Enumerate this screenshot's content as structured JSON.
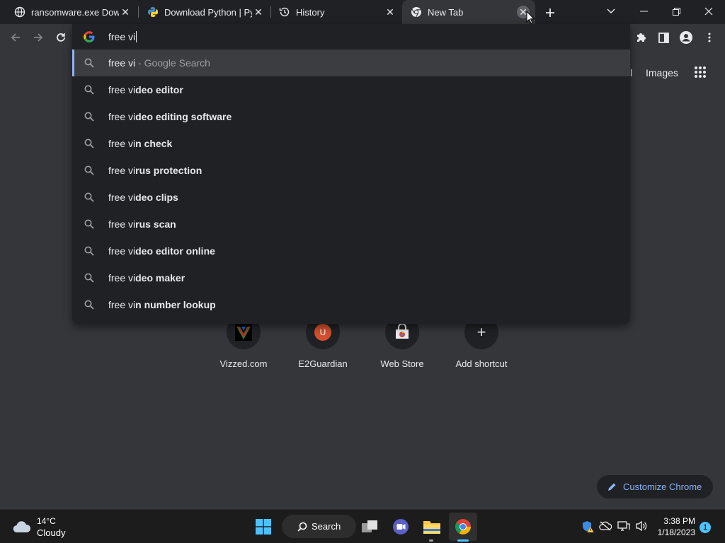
{
  "tabs": [
    {
      "title": "ransomware.exe Downl",
      "icon": "globe-icon"
    },
    {
      "title": "Download Python | Pyt",
      "icon": "python-icon"
    },
    {
      "title": "History",
      "icon": "history-icon"
    },
    {
      "title": "New Tab",
      "icon": "chrome-icon",
      "active": true
    }
  ],
  "omnibox": {
    "value": "free vi",
    "suggestions": [
      {
        "typed": "free vi",
        "rest": "",
        "hint": " - Google Search"
      },
      {
        "typed": "free vi",
        "rest": "deo editor"
      },
      {
        "typed": "free vi",
        "rest": "deo editing software"
      },
      {
        "typed": "free vi",
        "rest": "n check"
      },
      {
        "typed": "free vi",
        "rest": "rus protection"
      },
      {
        "typed": "free vi",
        "rest": "deo clips"
      },
      {
        "typed": "free vi",
        "rest": "rus scan"
      },
      {
        "typed": "free vi",
        "rest": "deo editor online"
      },
      {
        "typed": "free vi",
        "rest": "deo maker"
      },
      {
        "typed": "free vi",
        "rest": "n number lookup"
      }
    ]
  },
  "header": {
    "gmail_partial": "il",
    "images": "Images"
  },
  "shortcuts": [
    {
      "label": "Vizzed.com",
      "icon": "vizzed-icon"
    },
    {
      "label": "E2Guardian",
      "icon": "e2guardian-icon",
      "letter": "U"
    },
    {
      "label": "Web Store",
      "icon": "webstore-icon"
    },
    {
      "label": "Add shortcut",
      "icon": "plus-icon",
      "symbol": "+"
    }
  ],
  "customize": {
    "label": "Customize Chrome"
  },
  "taskbar": {
    "weather_temp": "14°C",
    "weather_cond": "Cloudy",
    "search_label": "Search",
    "time": "3:38 PM",
    "date": "1/18/2023",
    "notification_count": "1"
  },
  "colors": {
    "accent": "#8ab4f8",
    "tab_strip": "#202124",
    "page_bg": "#35363a",
    "taskbar": "#1c1c1c"
  }
}
